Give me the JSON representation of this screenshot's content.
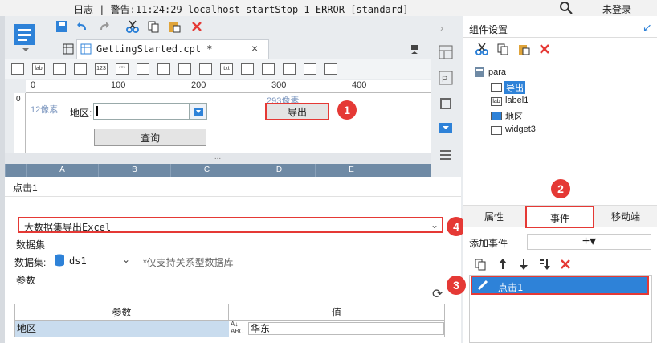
{
  "statusbar": {
    "message": "日志 | 警告:11:24:29 localhost-startStop-1 ERROR [standard]",
    "login": "未登录"
  },
  "tab": {
    "label": "GettingStarted.cpt *",
    "close": "×"
  },
  "ruler": {
    "ticks": [
      "0",
      "100",
      "200",
      "300",
      "400"
    ],
    "v_tick": "0"
  },
  "canvas": {
    "hint_left": "12像素",
    "area_label": "地区:",
    "hint_export": "293像素",
    "export_label": "导出",
    "query_label": "查询"
  },
  "grid": {
    "columns": [
      "A",
      "B",
      "C",
      "D",
      "E"
    ],
    "divider": "..."
  },
  "event_panel": {
    "title": "点击1",
    "action_value": "大数据集导出Excel",
    "dataset_section": "数据集",
    "dataset_label": "数据集:",
    "dataset_value": "ds1",
    "dataset_note": "*仅支持关系型数据库",
    "param_section": "参数",
    "param_headers": [
      "参数",
      "值"
    ],
    "param_rows": [
      {
        "name": "地区",
        "value": "华东"
      }
    ]
  },
  "right_panel": {
    "title": "组件设置",
    "tree": [
      "para",
      "导出",
      "label1",
      "地区",
      "widget3"
    ],
    "tabs": [
      "属性",
      "事件",
      "移动端"
    ],
    "add_event_label": "添加事件",
    "add_button": "+▾",
    "event_item": "点击1"
  },
  "badges": [
    "1",
    "2",
    "3",
    "4"
  ],
  "colors": {
    "accent": "#2e82d8",
    "highlight": "#e53935",
    "grid_header": "#6f8aa5"
  }
}
